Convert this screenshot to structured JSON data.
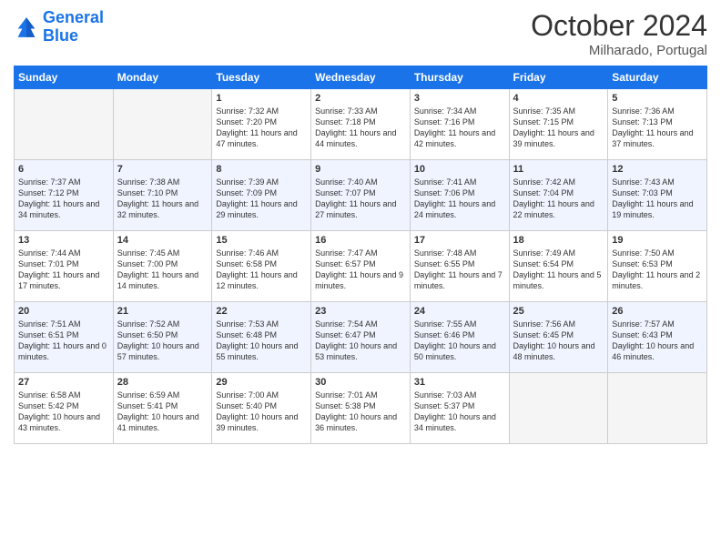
{
  "header": {
    "logo_general": "General",
    "logo_blue": "Blue",
    "month_title": "October 2024",
    "location": "Milharado, Portugal"
  },
  "weekdays": [
    "Sunday",
    "Monday",
    "Tuesday",
    "Wednesday",
    "Thursday",
    "Friday",
    "Saturday"
  ],
  "weeks": [
    [
      {
        "day": "",
        "info": ""
      },
      {
        "day": "",
        "info": ""
      },
      {
        "day": "1",
        "info": "Sunrise: 7:32 AM\nSunset: 7:20 PM\nDaylight: 11 hours and 47 minutes."
      },
      {
        "day": "2",
        "info": "Sunrise: 7:33 AM\nSunset: 7:18 PM\nDaylight: 11 hours and 44 minutes."
      },
      {
        "day": "3",
        "info": "Sunrise: 7:34 AM\nSunset: 7:16 PM\nDaylight: 11 hours and 42 minutes."
      },
      {
        "day": "4",
        "info": "Sunrise: 7:35 AM\nSunset: 7:15 PM\nDaylight: 11 hours and 39 minutes."
      },
      {
        "day": "5",
        "info": "Sunrise: 7:36 AM\nSunset: 7:13 PM\nDaylight: 11 hours and 37 minutes."
      }
    ],
    [
      {
        "day": "6",
        "info": "Sunrise: 7:37 AM\nSunset: 7:12 PM\nDaylight: 11 hours and 34 minutes."
      },
      {
        "day": "7",
        "info": "Sunrise: 7:38 AM\nSunset: 7:10 PM\nDaylight: 11 hours and 32 minutes."
      },
      {
        "day": "8",
        "info": "Sunrise: 7:39 AM\nSunset: 7:09 PM\nDaylight: 11 hours and 29 minutes."
      },
      {
        "day": "9",
        "info": "Sunrise: 7:40 AM\nSunset: 7:07 PM\nDaylight: 11 hours and 27 minutes."
      },
      {
        "day": "10",
        "info": "Sunrise: 7:41 AM\nSunset: 7:06 PM\nDaylight: 11 hours and 24 minutes."
      },
      {
        "day": "11",
        "info": "Sunrise: 7:42 AM\nSunset: 7:04 PM\nDaylight: 11 hours and 22 minutes."
      },
      {
        "day": "12",
        "info": "Sunrise: 7:43 AM\nSunset: 7:03 PM\nDaylight: 11 hours and 19 minutes."
      }
    ],
    [
      {
        "day": "13",
        "info": "Sunrise: 7:44 AM\nSunset: 7:01 PM\nDaylight: 11 hours and 17 minutes."
      },
      {
        "day": "14",
        "info": "Sunrise: 7:45 AM\nSunset: 7:00 PM\nDaylight: 11 hours and 14 minutes."
      },
      {
        "day": "15",
        "info": "Sunrise: 7:46 AM\nSunset: 6:58 PM\nDaylight: 11 hours and 12 minutes."
      },
      {
        "day": "16",
        "info": "Sunrise: 7:47 AM\nSunset: 6:57 PM\nDaylight: 11 hours and 9 minutes."
      },
      {
        "day": "17",
        "info": "Sunrise: 7:48 AM\nSunset: 6:55 PM\nDaylight: 11 hours and 7 minutes."
      },
      {
        "day": "18",
        "info": "Sunrise: 7:49 AM\nSunset: 6:54 PM\nDaylight: 11 hours and 5 minutes."
      },
      {
        "day": "19",
        "info": "Sunrise: 7:50 AM\nSunset: 6:53 PM\nDaylight: 11 hours and 2 minutes."
      }
    ],
    [
      {
        "day": "20",
        "info": "Sunrise: 7:51 AM\nSunset: 6:51 PM\nDaylight: 11 hours and 0 minutes."
      },
      {
        "day": "21",
        "info": "Sunrise: 7:52 AM\nSunset: 6:50 PM\nDaylight: 10 hours and 57 minutes."
      },
      {
        "day": "22",
        "info": "Sunrise: 7:53 AM\nSunset: 6:48 PM\nDaylight: 10 hours and 55 minutes."
      },
      {
        "day": "23",
        "info": "Sunrise: 7:54 AM\nSunset: 6:47 PM\nDaylight: 10 hours and 53 minutes."
      },
      {
        "day": "24",
        "info": "Sunrise: 7:55 AM\nSunset: 6:46 PM\nDaylight: 10 hours and 50 minutes."
      },
      {
        "day": "25",
        "info": "Sunrise: 7:56 AM\nSunset: 6:45 PM\nDaylight: 10 hours and 48 minutes."
      },
      {
        "day": "26",
        "info": "Sunrise: 7:57 AM\nSunset: 6:43 PM\nDaylight: 10 hours and 46 minutes."
      }
    ],
    [
      {
        "day": "27",
        "info": "Sunrise: 6:58 AM\nSunset: 5:42 PM\nDaylight: 10 hours and 43 minutes."
      },
      {
        "day": "28",
        "info": "Sunrise: 6:59 AM\nSunset: 5:41 PM\nDaylight: 10 hours and 41 minutes."
      },
      {
        "day": "29",
        "info": "Sunrise: 7:00 AM\nSunset: 5:40 PM\nDaylight: 10 hours and 39 minutes."
      },
      {
        "day": "30",
        "info": "Sunrise: 7:01 AM\nSunset: 5:38 PM\nDaylight: 10 hours and 36 minutes."
      },
      {
        "day": "31",
        "info": "Sunrise: 7:03 AM\nSunset: 5:37 PM\nDaylight: 10 hours and 34 minutes."
      },
      {
        "day": "",
        "info": ""
      },
      {
        "day": "",
        "info": ""
      }
    ]
  ]
}
